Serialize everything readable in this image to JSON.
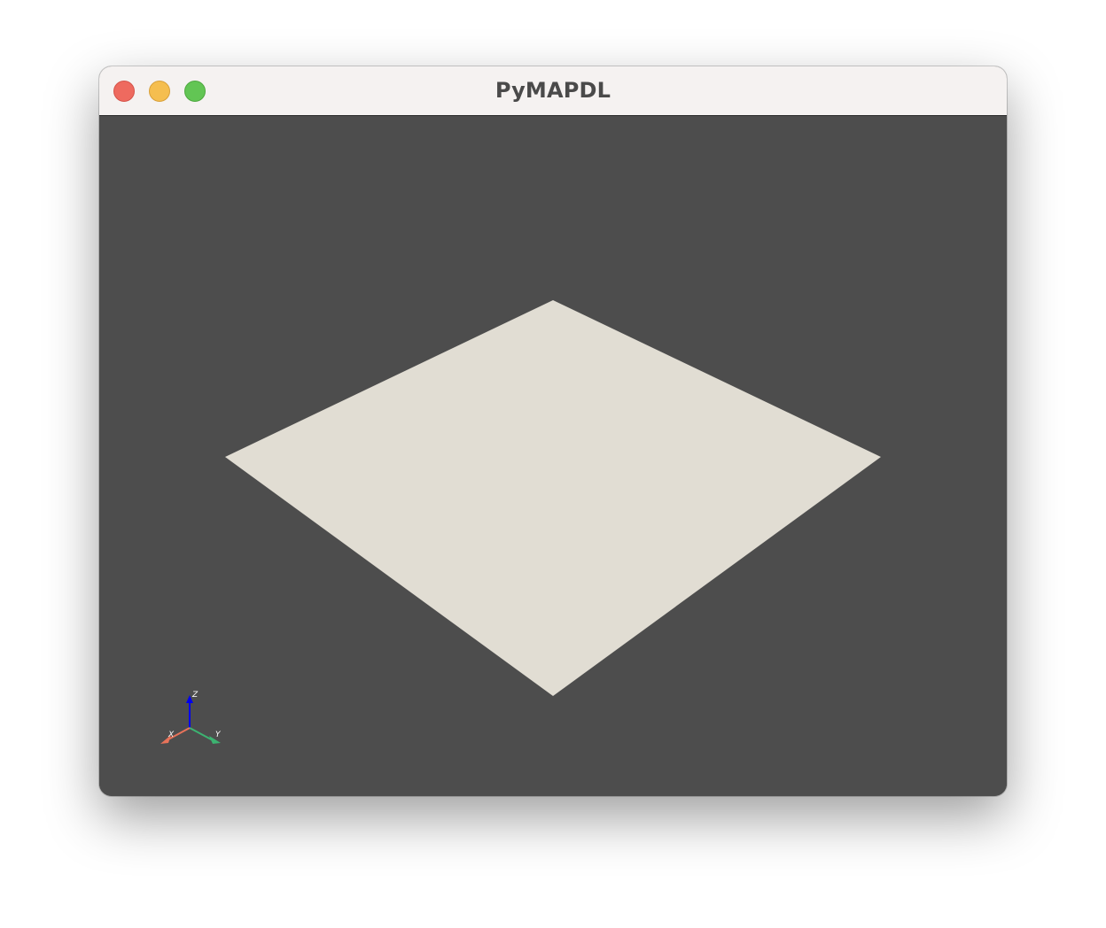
{
  "window": {
    "title": "PyMAPDL"
  },
  "controls": {
    "close": "close",
    "minimize": "minimize",
    "maximize": "maximize"
  },
  "scene": {
    "background_color": "#4d4d4d",
    "plate_color": "#e1ddd3",
    "object": "plate"
  },
  "axes_widget": {
    "x_label": "X",
    "y_label": "Y",
    "z_label": "Z",
    "x_color": "#e8735a",
    "y_color": "#3cb371",
    "z_color": "#0000ee"
  }
}
